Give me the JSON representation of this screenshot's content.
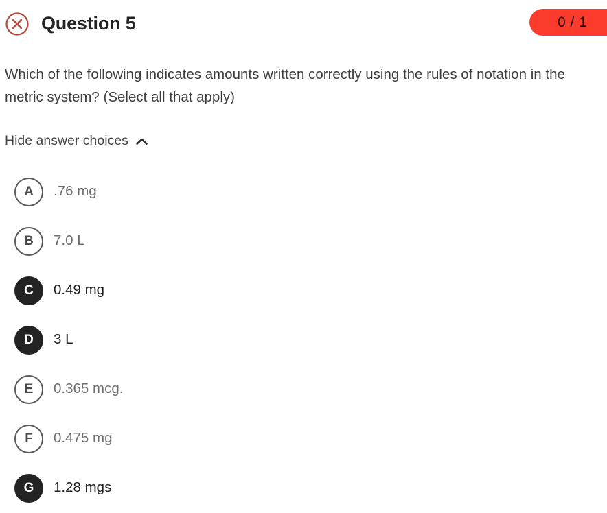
{
  "header": {
    "status_icon": "circle-x-icon",
    "status_icon_color": "#b04a3e",
    "title": "Question 5",
    "score": "0 / 1",
    "score_badge_color": "#fb3b2c"
  },
  "question": {
    "text": "Which of the following indicates amounts written correctly using the rules of notation in the metric system? (Select all that apply)"
  },
  "toggle": {
    "label": "Hide answer choices",
    "icon": "chevron-up-icon"
  },
  "choices": [
    {
      "letter": "A",
      "text": ".76 mg",
      "selected": false
    },
    {
      "letter": "B",
      "text": "7.0 L",
      "selected": false
    },
    {
      "letter": "C",
      "text": "0.49 mg",
      "selected": true
    },
    {
      "letter": "D",
      "text": "3 L",
      "selected": true
    },
    {
      "letter": "E",
      "text": "0.365 mcg.",
      "selected": false
    },
    {
      "letter": "F",
      "text": "0.475 mg",
      "selected": false
    },
    {
      "letter": "G",
      "text": "1.28 mgs",
      "selected": true
    }
  ]
}
